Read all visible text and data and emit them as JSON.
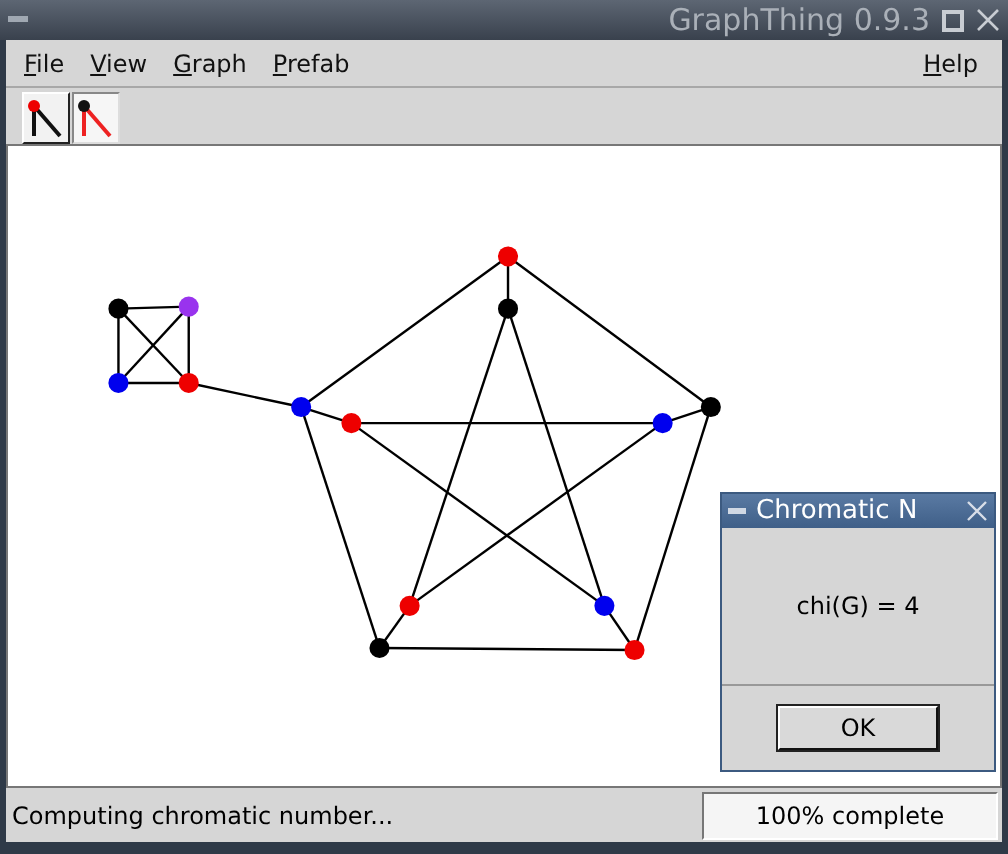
{
  "window": {
    "title": "GraphThing 0.9.3"
  },
  "menu": [
    {
      "label": "File"
    },
    {
      "label": "View"
    },
    {
      "label": "Graph"
    },
    {
      "label": "Prefab"
    }
  ],
  "help_menu": {
    "label": "Help"
  },
  "toolbar": [
    {
      "kind": "vertex",
      "selected": true
    },
    {
      "kind": "edge",
      "selected": false
    }
  ],
  "graph": {
    "nodes": [
      {
        "color": "#ee0000"
      },
      {
        "color": "#0000ee"
      },
      {
        "color": "#000000"
      },
      {
        "color": "#000000"
      },
      {
        "color": "#ee0000"
      },
      {
        "color": "#000000"
      },
      {
        "color": "#ee0000"
      },
      {
        "color": "#0000ee"
      },
      {
        "color": "#ee0000"
      },
      {
        "color": "#0000ee"
      },
      {
        "color": "#000000"
      },
      {
        "color": "#9933ee"
      },
      {
        "color": "#0000ee"
      },
      {
        "color": "#ee0000"
      }
    ]
  },
  "dialog": {
    "title": "Chromatic N",
    "message": "chi(G) = 4",
    "button": "OK"
  },
  "status_bar": {
    "message": "Computing chromatic number...",
    "progress": {
      "text": "100% complete",
      "level": 1
    }
  }
}
